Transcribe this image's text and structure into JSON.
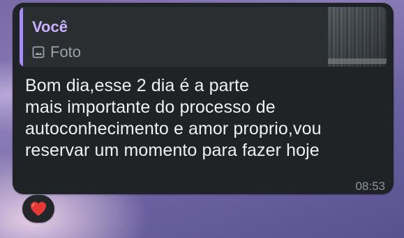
{
  "message": {
    "reply": {
      "author": "Você",
      "media_label": "Foto",
      "media_icon": "photo-icon"
    },
    "text": "Bom dia,esse 2 dia é a parte\nmais importante do processo de\nautoconhecimento e amor proprio,vou\nreservar um momento para fazer hoje",
    "time": "08:53",
    "reaction": {
      "icon": "red-heart-icon",
      "color": "#e53935"
    },
    "colors": {
      "bubble": "#1f2326",
      "quote_accent": "#a78bfa",
      "author": "#c9b2ff"
    }
  }
}
